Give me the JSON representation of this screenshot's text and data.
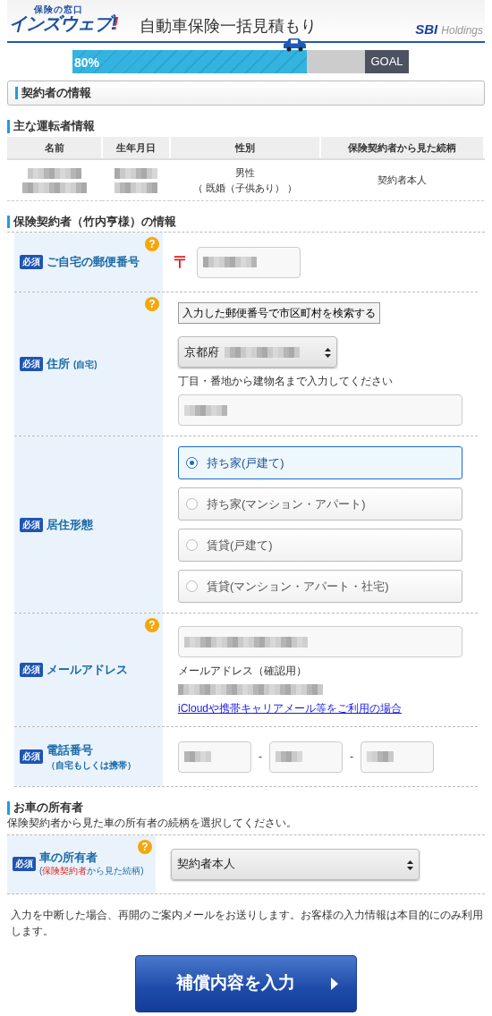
{
  "header": {
    "logo_caption": "保険の窓口",
    "logo": "インズウェブ",
    "logo_mark": "!",
    "title": "自動車保険一括見積もり",
    "brand": "SBI",
    "brand_suffix": "Holdings"
  },
  "progress": {
    "level": 0.8,
    "label": "80%",
    "goal": "GOAL"
  },
  "section_title": "契約者の情報",
  "driver": {
    "title": "主な運転者情報",
    "columns": [
      "名前",
      "生年月日",
      "性別",
      "保険契約者から見た続柄"
    ],
    "cells": [
      {
        "redacted": true
      },
      {
        "redacted": true
      },
      {
        "lines": [
          "男性",
          "（ 既婚（子供あり） ）"
        ]
      },
      {
        "lines": [
          "契約者本人"
        ]
      }
    ]
  },
  "policyholder": {
    "title": "保険契約者（竹内亨様）の情報",
    "rows": [
      {
        "kind": "postal",
        "required": "必須",
        "label": "ご自宅の郵便番号",
        "help": "?",
        "postal_mark": "〒",
        "redacted": true
      },
      {
        "kind": "address",
        "required": "必須",
        "label": "住所",
        "label_note": "(自宅)",
        "help": "?",
        "search_button": "入力した郵便番号で市区町村を検索する",
        "select_value": "京都府",
        "select_redacted": true,
        "hint": "丁目・番地から建物名まで入力してください",
        "redacted": true
      },
      {
        "kind": "housing",
        "required": "必須",
        "label": "居住形態",
        "options": [
          {
            "label": "持ち家(戸建て)",
            "selected": true
          },
          {
            "label": "持ち家(マンション・アパート)",
            "selected": false
          },
          {
            "label": "賃貸(戸建て)",
            "selected": false
          },
          {
            "label": "賃貸(マンション・アパート・社宅)",
            "selected": false
          }
        ]
      },
      {
        "kind": "email",
        "required": "必須",
        "label": "メールアドレス",
        "help": "?",
        "redacted": true,
        "confirm_label": "メールアドレス（確認用）",
        "confirm_redacted": true,
        "link": "iCloudや携帯キャリアメール等をご利用の場合"
      },
      {
        "kind": "phone",
        "required": "必須",
        "label": "電話番号",
        "label_note": "（自宅もしくは携帯）",
        "parts": [
          {
            "redacted": true
          },
          {
            "redacted": true
          },
          {
            "redacted": true
          }
        ],
        "separator": "-"
      }
    ]
  },
  "owner": {
    "title": "お車の所有者",
    "description": "保険契約者から見た車の所有者の続柄を選択してください。",
    "required": "必須",
    "label": "車の所有者",
    "note_open": "(",
    "note_highlight": "保険契約者",
    "note_rest": "から見た続柄)",
    "help": "?",
    "select_value": "契約者本人"
  },
  "notice": "入力を中断した場合、再開のご案内メールをお送りします。お客様の入力情報は本目的にのみ利用します。",
  "submit": "補償内容を入力"
}
